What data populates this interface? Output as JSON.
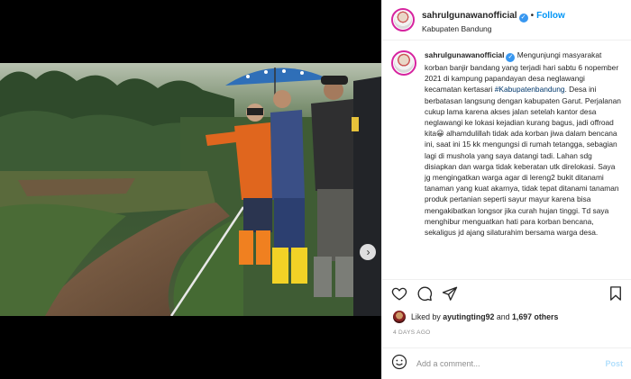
{
  "post": {
    "username": "sahrulgunawanofficial",
    "follow_label": "Follow",
    "dot": "•",
    "location": "Kabupaten Bandung",
    "caption_username": "sahrulgunawanofficial",
    "caption_part1": "Mengunjungi masyarakat korban banjir bandang yang terjadi hari sabtu 6 nopember 2021 di kampung papandayan desa neglawangi kecamatan kertasari ",
    "caption_hashtag": "#Kabupatenbandung",
    "caption_part2": ". Desa ini berbatasan langsung dengan kabupaten Garut. Perjalanan cukup lama karena akses jalan setelah kantor desa neglawangi ke lokasi kejadian kurang bagus, jadi offroad kita😀 alhamdulillah tidak ada korban jiwa dalam bencana ini, saat ini 15 kk mengungsi di rumah tetangga, sebagian lagi di mushola yang saya datangi tadi. Lahan sdg disiapkan dan warga tidak keberatan utk direlokasi. Saya jg mengingatkan warga agar di lereng2 bukit ditanami tanaman yang kuat akarnya, tidak tepat ditanami tanaman produk pertanian seperti sayur mayur karena bisa mengakibatkan longsor jika curah hujan tinggi. Td saya menghibur menguatkan hati para korban bencana, sekaligus jd ajang silaturahim bersama warga desa."
  },
  "engagement": {
    "liked_by_prefix": "Liked by ",
    "liked_by_user": "ayutingting92",
    "liked_by_mid": " and ",
    "likes_count": "1,697 others",
    "date": "4 DAYS AGO"
  },
  "comment": {
    "placeholder": "Add a comment...",
    "post_label": "Post"
  },
  "icons": {
    "like": "heart-icon",
    "comment": "comment-icon",
    "share": "share-icon",
    "save": "bookmark-icon",
    "emoji": "emoji-icon",
    "next": "chevron-right-icon"
  },
  "colors": {
    "accent": "#0095f6",
    "verified": "#3897f0",
    "hashtag": "#00376b",
    "muted": "#8e8e8e"
  }
}
